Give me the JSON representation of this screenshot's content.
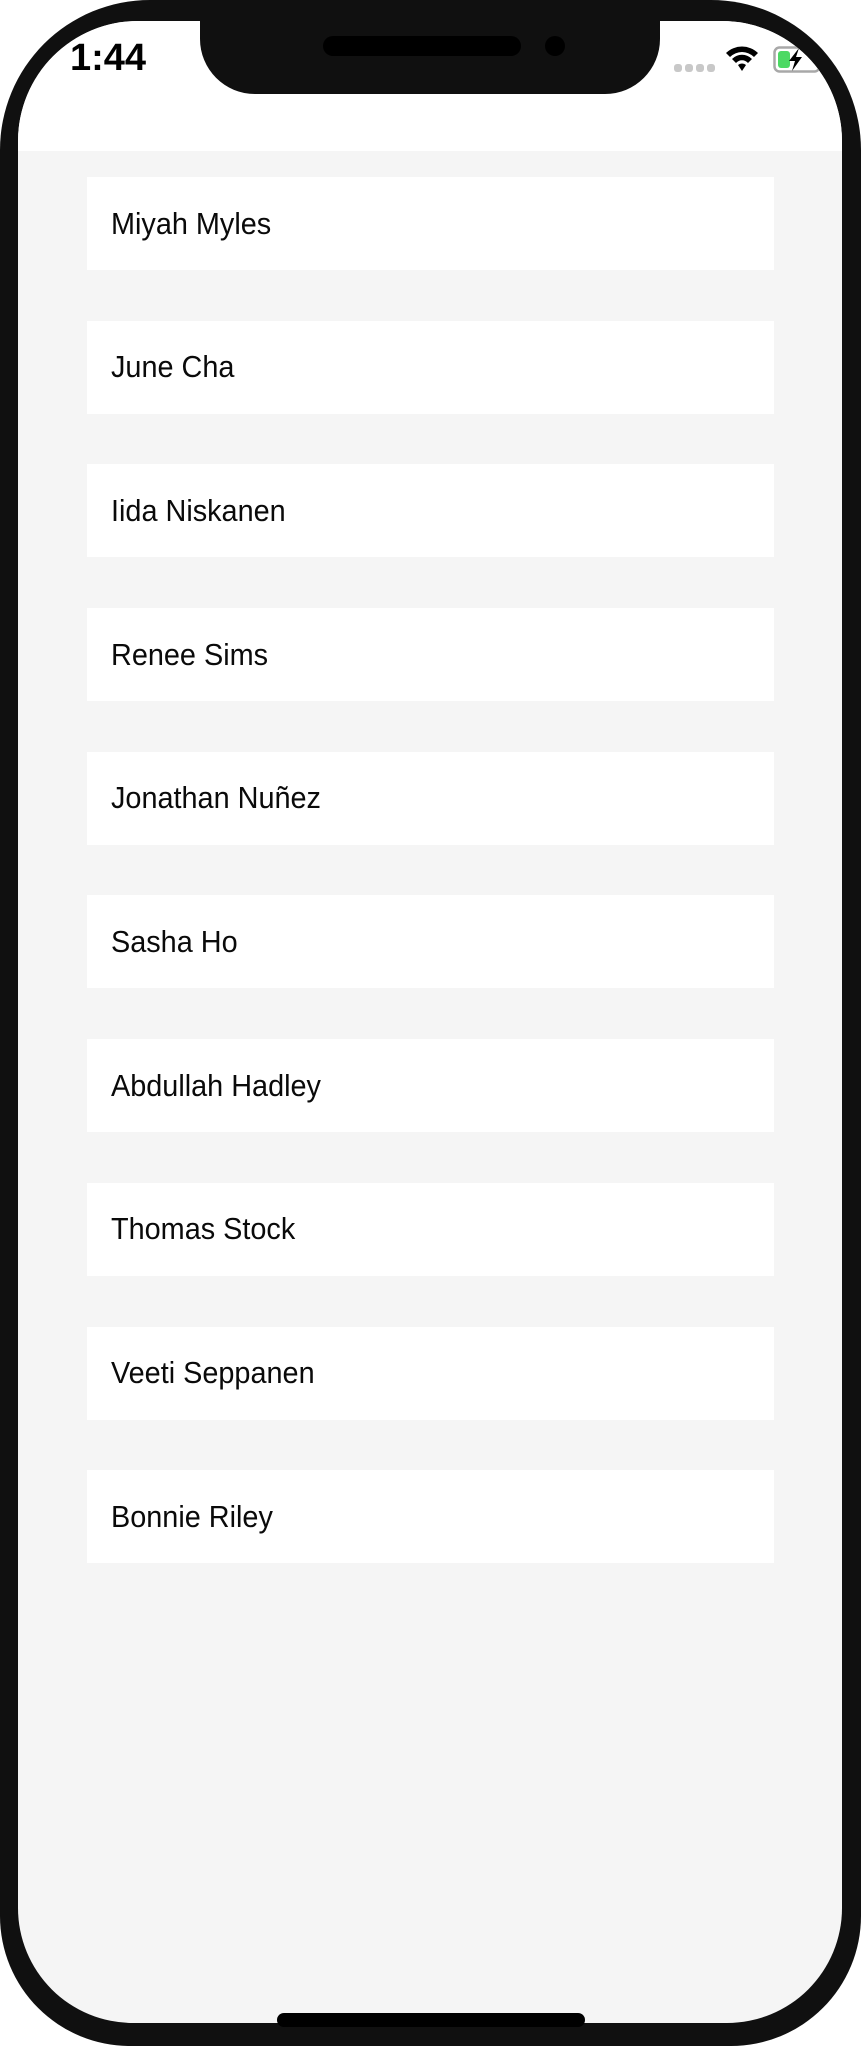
{
  "status_bar": {
    "time": "1:44",
    "signal_icon": "cellular-signal-icon",
    "wifi_icon": "wifi-icon",
    "battery_icon": "battery-charging-icon",
    "battery_color": "#4cd964"
  },
  "contacts": [
    {
      "name": "Miyah Myles"
    },
    {
      "name": "June Cha"
    },
    {
      "name": "Iida Niskanen"
    },
    {
      "name": "Renee Sims"
    },
    {
      "name": "Jonathan Nuñez"
    },
    {
      "name": "Sasha Ho"
    },
    {
      "name": "Abdullah Hadley"
    },
    {
      "name": "Thomas Stock"
    },
    {
      "name": "Veeti Seppanen"
    },
    {
      "name": "Bonnie Riley"
    }
  ],
  "colors": {
    "background": "#f5f5f5",
    "card": "#ffffff",
    "text": "#0a0a0a"
  }
}
